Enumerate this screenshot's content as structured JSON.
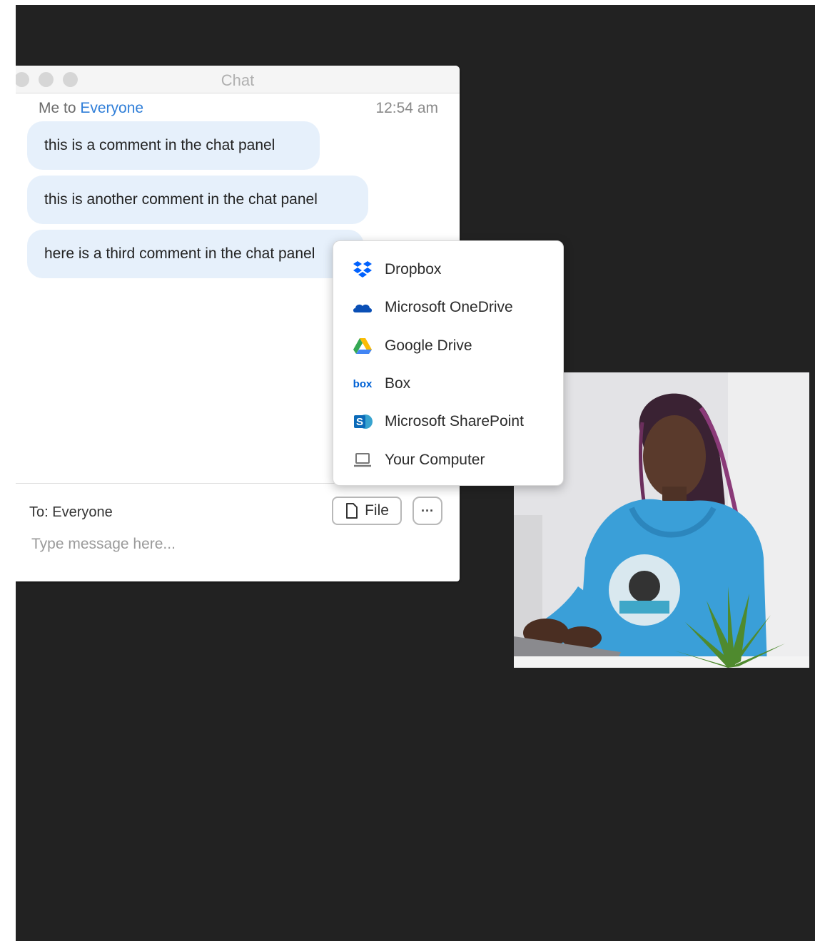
{
  "chat": {
    "window_title": "Chat",
    "header": {
      "sender": "Me to",
      "recipient": "Everyone",
      "time": "12:54 am"
    },
    "messages": [
      "this is a comment in the chat panel",
      "this is another comment in the chat panel",
      "here is a third comment in the chat panel"
    ],
    "composer": {
      "to_label": "To: Everyone",
      "file_button": "File",
      "more_button": "···",
      "placeholder": "Type message here..."
    }
  },
  "file_menu": {
    "items": [
      {
        "label": "Dropbox",
        "icon": "dropbox-icon"
      },
      {
        "label": "Microsoft OneDrive",
        "icon": "onedrive-icon"
      },
      {
        "label": "Google Drive",
        "icon": "google-drive-icon"
      },
      {
        "label": "Box",
        "icon": "box-icon",
        "icon_text": "box"
      },
      {
        "label": "Microsoft SharePoint",
        "icon": "sharepoint-icon",
        "icon_text": "S"
      },
      {
        "label": "Your Computer",
        "icon": "computer-icon"
      }
    ]
  },
  "colors": {
    "stage_bg": "#222222",
    "bubble_bg": "#e6f0fb",
    "link": "#2f7ed8",
    "hoodie": "#3a9fd8"
  }
}
